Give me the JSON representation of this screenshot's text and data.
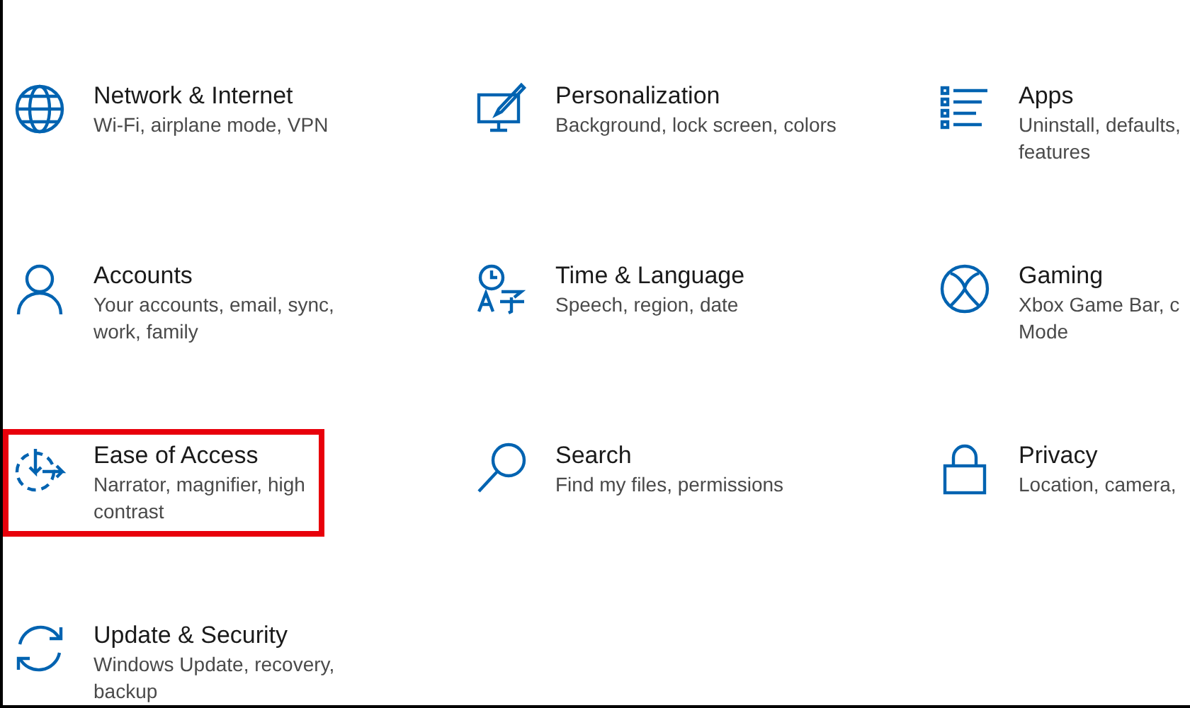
{
  "items": [
    {
      "title": "Network & Internet",
      "description": [
        "Wi-Fi, airplane mode, VPN"
      ],
      "highlighted": false
    },
    {
      "title": "Personalization",
      "description": [
        "Background, lock screen, colors"
      ],
      "highlighted": false
    },
    {
      "title": "Apps",
      "description": [
        "Uninstall, defaults,",
        "features"
      ],
      "highlighted": false
    },
    {
      "title": "Accounts",
      "description": [
        "Your accounts, email, sync,",
        "work, family"
      ],
      "highlighted": false
    },
    {
      "title": "Time & Language",
      "description": [
        "Speech, region, date"
      ],
      "highlighted": false
    },
    {
      "title": "Gaming",
      "description": [
        "Xbox Game Bar, c",
        "Mode"
      ],
      "highlighted": false
    },
    {
      "title": "Ease of Access",
      "description": [
        "Narrator, magnifier, high",
        "contrast"
      ],
      "highlighted": true
    },
    {
      "title": "Search",
      "description": [
        "Find my files, permissions"
      ],
      "highlighted": false
    },
    {
      "title": "Privacy",
      "description": [
        "Location, camera,"
      ],
      "highlighted": false
    },
    {
      "title": "Update & Security",
      "description": [
        "Windows Update, recovery,",
        "backup"
      ],
      "highlighted": false
    }
  ]
}
